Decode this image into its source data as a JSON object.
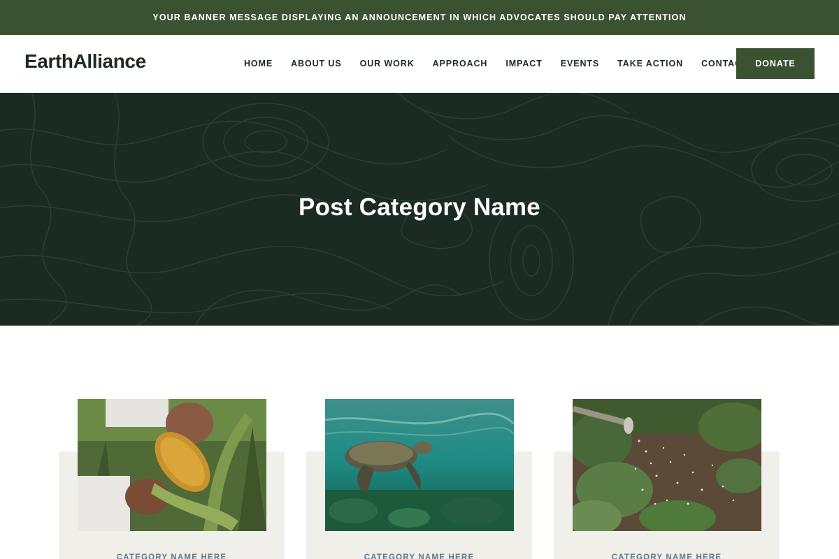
{
  "banner": {
    "message": "YOUR BANNER MESSAGE DISPLAYING AN ANNOUNCEMENT IN WHICH ADVOCATES SHOULD PAY ATTENTION"
  },
  "header": {
    "logo": "EarthAlliance",
    "nav": [
      "HOME",
      "ABOUT US",
      "OUR WORK",
      "APPROACH",
      "IMPACT",
      "EVENTS",
      "TAKE ACTION",
      "CONTACT"
    ],
    "donate_label": "DONATE"
  },
  "hero": {
    "title": "Post Category Name"
  },
  "cards": [
    {
      "image": "corn-harvest-photo",
      "category": "CATEGORY NAME HERE"
    },
    {
      "image": "sea-turtle-photo",
      "category": "CATEGORY NAME HERE"
    },
    {
      "image": "garden-watering-photo",
      "category": "CATEGORY NAME HERE"
    }
  ],
  "colors": {
    "brand_green": "#3b5232",
    "hero_bg": "#1c2b21",
    "card_bg": "#f0efea",
    "category_text": "#5a7a8c"
  }
}
